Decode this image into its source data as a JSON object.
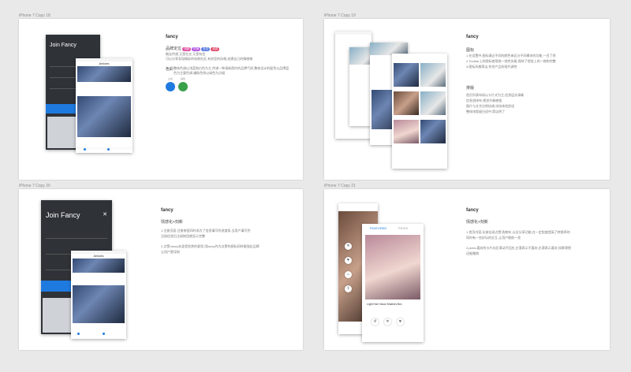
{
  "boards": [
    {
      "label": "iPhone 7 Copy 18",
      "title": "fancy",
      "brand_label": "品牌定位",
      "badges": [
        "创新",
        "时尚",
        "社交",
        "品质"
      ],
      "brand_lines": [
        "概念传递,又是社交,又是有型",
        "可以分享发现精彩的电商社区,有别型的风格,创建自己的情感物"
      ],
      "color_label": "色彩",
      "color_text": "整体色调以浅蓝和白色为主,传递一种清新简约的品牌气质,整体设计的配色以品牌蓝色为主要色调,辅助色则以绿色为点缀",
      "swatch1_label": "主色",
      "swatch2_label": "辅色",
      "phone_title": "Join Fancy",
      "articles_title": "Articles"
    },
    {
      "label": "iPhone 7 Copy 19",
      "title": "fancy",
      "icon_label": "图标",
      "icon_lines": [
        "1.在设置中,图标通过不同的颜色来区分不同模块的功能,一目了然",
        "2.Toolbar上的图标使用统一线性风格,保持了视觉上的一致和完整",
        "3.图标风格简洁,符合产品的现代调性"
      ],
      "layout_label": "排版",
      "layout_lines": [
        "首页列表布局以卡片式为主,信息层次清晰",
        "信息流排布,视觉节奏感强",
        "图片与文字比例协调,浏览体验舒适",
        "整体排版留白适中,简洁明了"
      ],
      "articles_title": "Articles"
    },
    {
      "label": "iPhone 7 Copy 20",
      "title": "fancy",
      "sub": "情感化+刻新",
      "lines": [
        "1.注册页面:注册按钮同时成为了信息填写的进度条,当用户填写完",
        "注册信息后注册按钮就显示完整",
        "2.点赞:fancy本身是欣赏的意思,用fancy作为点赞的图标同时能强化品牌",
        "让用户更深刻"
      ],
      "phone_title": "Join Fancy",
      "articles_title": "Articles"
    },
    {
      "label": "iPhone 7 Copy 21",
      "title": "fancy",
      "sub": "情感化+刻新",
      "lines": [
        "1.首页内容:长按出现点赞,购物车,以及分享功能,在一定程度提高了转换率的",
        "同时有一些好玩的交互,让用户眼前一亮",
        "2.picks:喜欢的卡片向后滑动不回应,左滑表示不喜欢,右滑表示喜欢,如果滑错",
        "还能撤销"
      ],
      "tab1": "FEATURED",
      "tab2": "PICKS",
      "card_caption": "Light Hair Vasor Mashes Bra"
    }
  ],
  "colors": {
    "primary": "#1f7ae0",
    "secondary": "#3aa04a"
  }
}
